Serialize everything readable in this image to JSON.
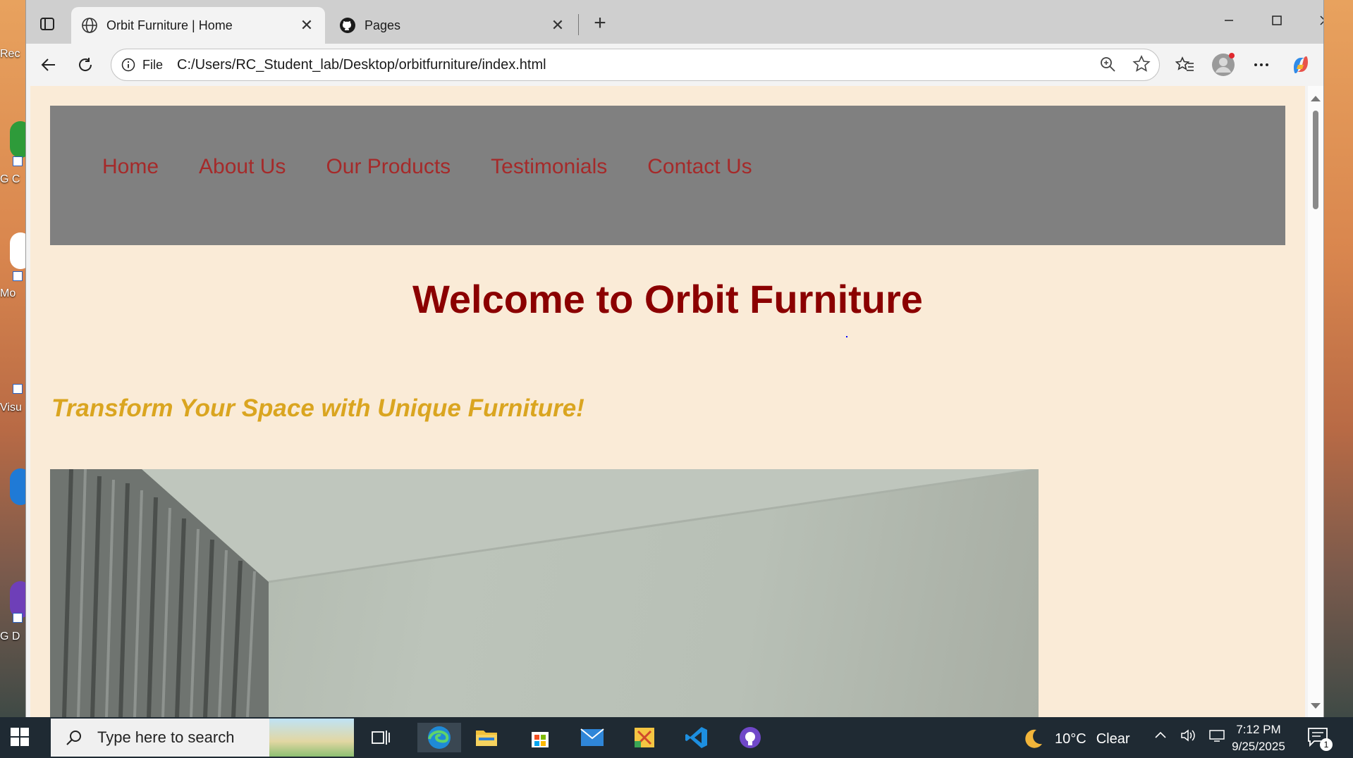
{
  "desktop": {
    "icon_labels": [
      "Rec",
      "G C",
      "Mo",
      "Visu",
      "G D"
    ]
  },
  "browser": {
    "tabs": [
      {
        "title": "Orbit Furniture | Home",
        "icon": "globe-icon",
        "active": true
      },
      {
        "title": "Pages",
        "icon": "github-icon",
        "active": false
      }
    ],
    "new_tab_label": "+",
    "close_glyph": "✕",
    "address": {
      "security_label": "File",
      "url": "C:/Users/RC_Student_lab/Desktop/orbitfurniture/index.html"
    }
  },
  "page": {
    "nav": [
      "Home",
      "About Us",
      "Our Products",
      "Testimonials",
      "Contact Us"
    ],
    "welcome": "Welcome to Orbit Furniture",
    "tagline": "Transform Your Space with Unique Furniture!",
    "colors": {
      "background": "#faebd7",
      "nav_bg": "#808080",
      "nav_link": "#a52a2a",
      "heading": "#8b0000",
      "tagline": "#daa520"
    }
  },
  "taskbar": {
    "search_placeholder": "Type here to search",
    "weather": {
      "temp": "10°C",
      "condition": "Clear"
    },
    "clock": {
      "time": "7:12 PM",
      "date": "9/25/2025"
    },
    "notification_count": "1"
  }
}
